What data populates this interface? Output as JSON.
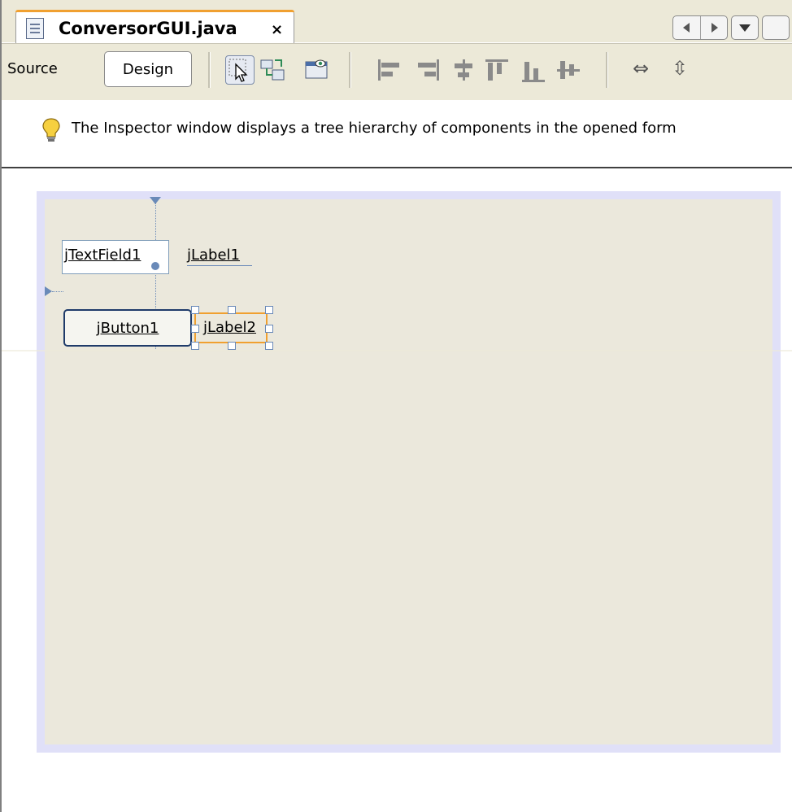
{
  "editor": {
    "tab_title": "ConversorGUI.java",
    "close_glyph": "×"
  },
  "toolbar": {
    "source_label": "Source",
    "design_label": "Design",
    "icons": [
      "selection-mode-icon",
      "connection-mode-icon",
      "preview-design-icon",
      "align-left-icon",
      "align-right-icon",
      "center-horizontally-icon",
      "align-top-icon",
      "align-bottom-icon",
      "center-vertically-icon",
      "change-horizontal-resizability-icon",
      "change-vertical-resizability-icon"
    ]
  },
  "hint": {
    "text": "The Inspector window displays a tree hierarchy of components in the opened form"
  },
  "form": {
    "components": {
      "text_field": "jTextField1",
      "label1": "jLabel1",
      "button": "jButton1",
      "label2": "jLabel2"
    }
  },
  "colors": {
    "panel_bg": "#ece9d8",
    "canvas_bg": "#ebe8dc",
    "guide": "#6a8ab8",
    "selection": "#f0a030"
  }
}
